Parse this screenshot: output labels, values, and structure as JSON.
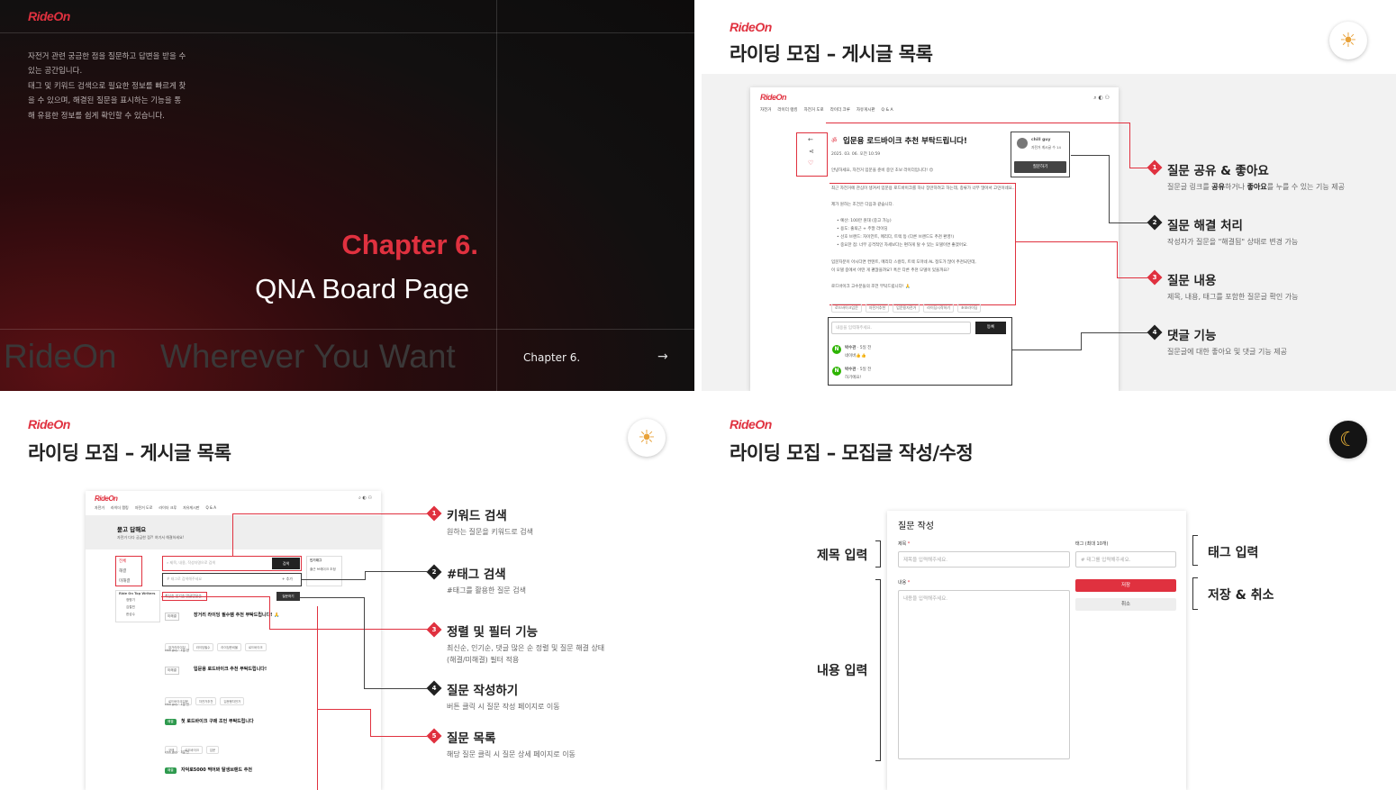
{
  "brand": "RideOn",
  "slide1": {
    "intro_lines": [
      "자전거 관련 궁금한 점을 질문하고 답변을 받을 수",
      "있는 공간입니다.",
      "태그 및 키워드 검색으로 필요한 정보를 빠르게 찾",
      "을 수 있으며, 해결된 질문을 표시하는 기능을 통",
      "해 유용한 정보를 쉽게 확인할 수 있습니다."
    ],
    "chapter_title": "Chapter 6.",
    "chapter_subtitle": "QNA Board Page",
    "bg_word_1": "RideOn",
    "bg_word_2": "Wherever You Want",
    "nav_label": "Chapter 6.",
    "nav_arrow": "→"
  },
  "slide2": {
    "title": "라이딩 모집 – 게시글 목록",
    "mock": {
      "nav": [
        "자전거",
        "라이더 랭킹",
        "자전거 도로",
        "라이더 크루",
        "자유게시판",
        "Q & A"
      ],
      "post_title": "입문용 로드바이크 추천 부탁드립니다!",
      "post_date": "2025. 03. 06. 오전 10:59",
      "author": "chill guy",
      "author_sub": "자전거 게시글 수 14",
      "ask_button": "질문하기",
      "body_lines": [
        "안녕하세요, 자전거 입문을 준비 중인 초보 라이더입니다! 😊",
        "최근 자전거에 관심이 생겨서 입문용 로드바이크를 하나 장만하려고 하는데, 종류가 너무 많아서 고민이네요..",
        "제가 원하는 조건은 다음과 같습니다.",
        "• 예산: 100만 원대 (중고 가능)",
        "• 용도: 출퇴근 + 주말 라이딩",
        "• 선호 브랜드: 자이언트, 메리다, 트렉 등 (다른 브랜드도 추천 환영!)",
        "• 중요한 점: 너무 공격적인 자세보다는 편하게 탈 수 있는 모델이면 좋겠어요.",
        "입문자분이 아시다면 컨텐트, 메리다 스컬티, 트렉 도마네 AL 정도가 많이 추천되던데,",
        "이 모델 중에서 어떤 게 괜찮을까요? 혹은 다른 추천 모델이 있을까요?",
        "로드바이크 고수분들의 조언 부탁드립니다! 🙏"
      ],
      "tags": [
        "로드바이크입문",
        "자전거추천",
        "입문용자전거",
        "라이딩시작하기",
        "초보라이딩"
      ],
      "comment_placeholder": "내용을 입력해주세요.",
      "comment_submit": "등록",
      "comments": [
        {
          "name": "박수관",
          "time": "· 5일 전",
          "text": "네이버👍👍"
        },
        {
          "name": "박수관",
          "time": "· 5일 전",
          "text": "하기에요!"
        }
      ]
    },
    "annotations": [
      {
        "num": "1",
        "title": "질문 공유 & 좋아요",
        "desc_pre": "질문글 링크를 ",
        "desc_b1": "공유",
        "desc_mid": "하거나 ",
        "desc_b2": "좋아요",
        "desc_post": "를 누를 수 있는 기능 제공"
      },
      {
        "num": "2",
        "title": "질문 해결 처리",
        "desc": "작성자가 질문을 \"해결됨\" 상태로 변경 가능"
      },
      {
        "num": "3",
        "title": "질문 내용",
        "desc": "제목, 내용, 태그를 포함한 질문글 확인 가능"
      },
      {
        "num": "4",
        "title": "댓글 기능",
        "desc": "질문글에 대한 좋아요 및 댓글 기능 제공"
      }
    ]
  },
  "slide3": {
    "title": "라이딩 모집 – 게시글 목록",
    "mock": {
      "nav": [
        "자전거",
        "라이더 랭킹",
        "자전거 도로",
        "라이더 크루",
        "자유게시판",
        "Q & A"
      ],
      "banner_title": "묻고 답해요",
      "banner_sub": "자전거 다다 궁금한 점?! 여기서 해결하세요!",
      "filters": [
        "전체",
        "해결",
        "미해결"
      ],
      "top_writers_title": "Ride On Top Writers",
      "top_writers": [
        "정병기",
        "김철민",
        "한성수"
      ],
      "search_placeholder": "제목, 내용, 작성자명으로 검색",
      "search_button": "검색",
      "tag_placeholder": "태그로 검색해주세요",
      "tag_add": "+ 추가",
      "popular_tags_title": "인기태그",
      "popular_tags": [
        "출근",
        "브레이크 조정"
      ],
      "sorts": [
        "최신순",
        "인기순",
        "댓글많은순"
      ],
      "ask_button": "질문하기",
      "posts": [
        {
          "badge": "미해결",
          "title": "장거리 라이딩 필수템 추천 부탁드립니다! 🙏",
          "tags": [
            "장거리라이딩",
            "라이딩필수",
            "라이딩준비물",
            "로드바이크"
          ],
          "meta": "chill guy · 1일 전"
        },
        {
          "badge": "미해결",
          "title": "입문용 로드바이크 추천 부탁드립니다!",
          "tags": [
            "로드바이크입문",
            "자전거추천",
            "입문용자전거"
          ],
          "meta": "chill guy · 1일 전"
        },
        {
          "badge": "해결",
          "title": "첫 로드바이크 구매 조언 부탁드립니다",
          "tags": [
            "구매",
            "로드바이크",
            "입문"
          ],
          "meta": "chill guy · 3일 전"
        },
        {
          "badge": "해결",
          "title": "자덕로5000 찍어봐 탈생브랜드 추천",
          "tags": [],
          "meta": ""
        }
      ]
    },
    "annotations": [
      {
        "num": "1",
        "title": "키워드 검색",
        "desc": "원하는 질문을 키워드로 검색"
      },
      {
        "num": "2",
        "title": "#태그 검색",
        "desc": "#태그를 활용한 질문 검색"
      },
      {
        "num": "3",
        "title": "정렬 및 필터 기능",
        "desc": "최신순, 인기순, 댓글 많은 순 정렬 및 질문 해결 상태",
        "desc2": "(해결/미해결) 필터 적용"
      },
      {
        "num": "4",
        "title": "질문 작성하기",
        "desc": "버튼 클릭 시 질문 작성 페이지로 이동"
      },
      {
        "num": "5",
        "title": "질문 목록",
        "desc": "해당 질문 클릭 시 질문 상세 페이지로 이동"
      }
    ]
  },
  "slide4": {
    "title": "라이딩 모집 – 모집글 작성/수정",
    "form": {
      "heading": "질문 작성",
      "title_label": "제목",
      "title_placeholder": "제목을 입력해주세요.",
      "tag_label": "태그 (최대 10개)",
      "tag_placeholder": "태그를 입력해주세요.",
      "content_label": "내용",
      "content_placeholder": "내용을 입력해주세요.",
      "save": "저장",
      "cancel": "취소"
    },
    "labels": {
      "title_input": "제목 입력",
      "content_input": "내용 입력",
      "tag_input": "태그 입력",
      "save_cancel": "저장 & 취소"
    }
  },
  "colors": {
    "accent": "#e0313f",
    "dark": "#222222"
  },
  "icons": {
    "sun": "sun-icon",
    "moon": "moon-icon"
  }
}
